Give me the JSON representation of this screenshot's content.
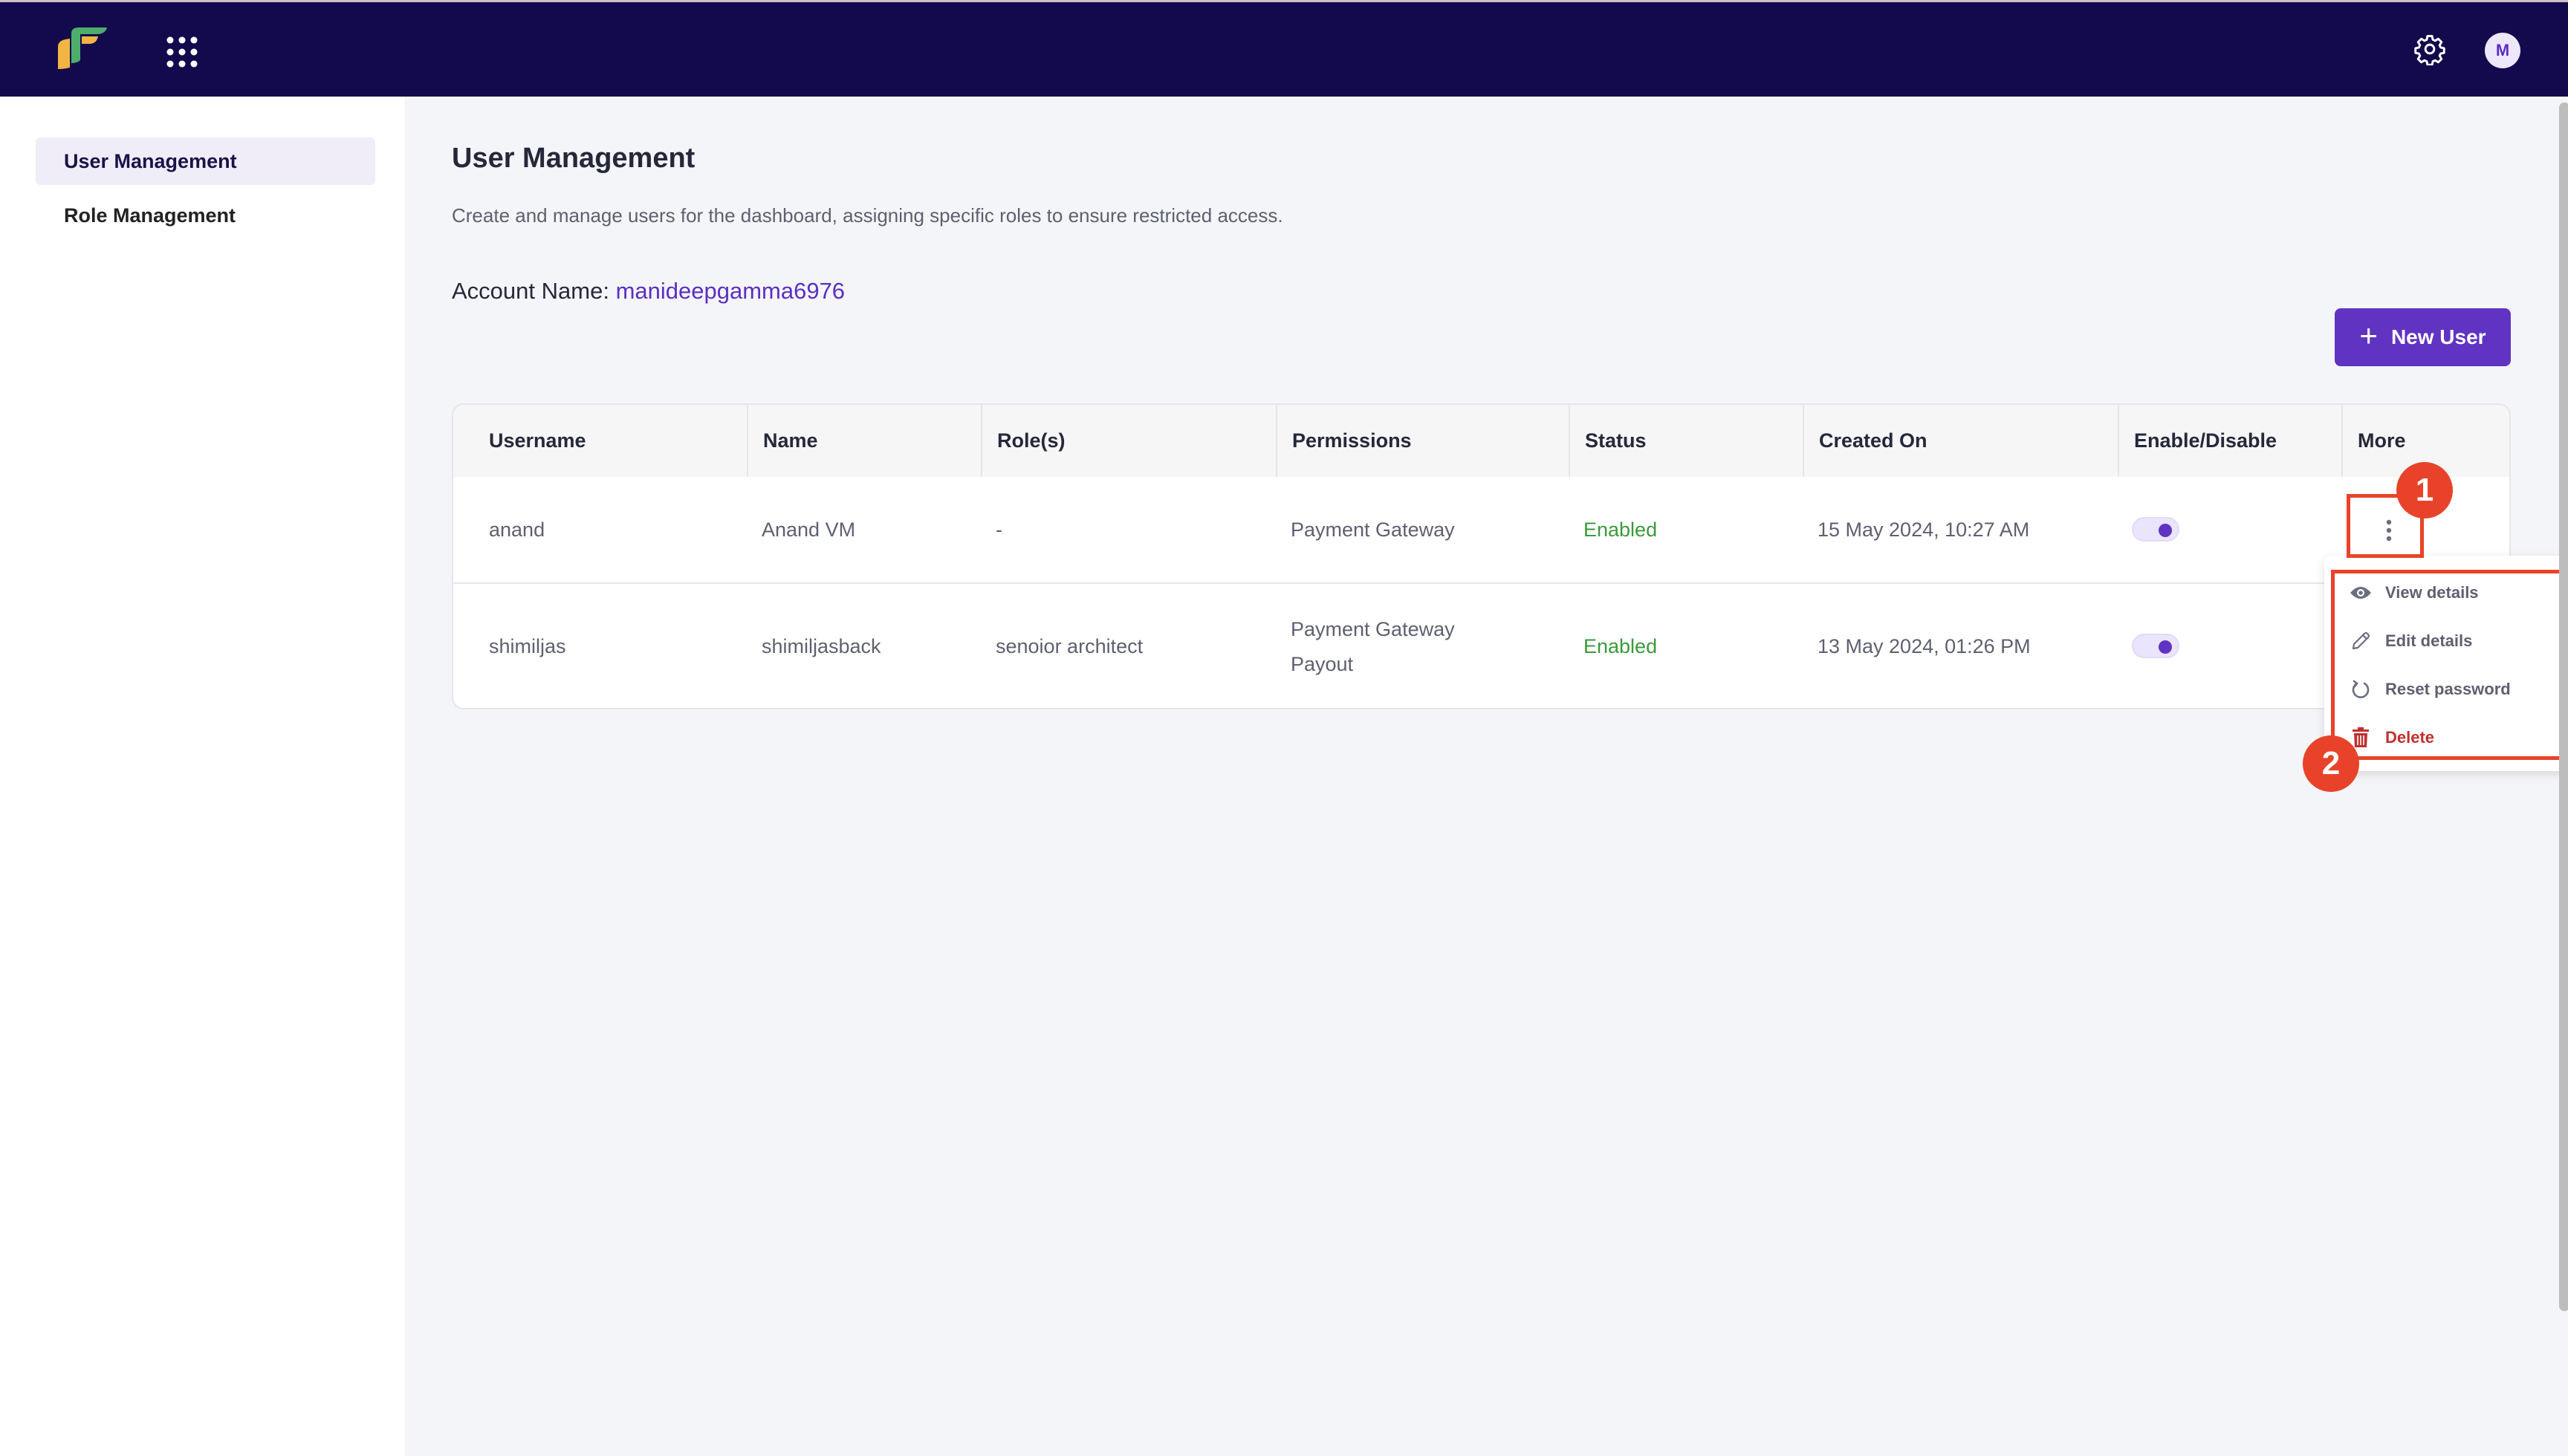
{
  "topbar": {
    "logo_icon": "brand-logo",
    "apps_icon": "grid-dots-icon",
    "settings_icon": "gear-icon",
    "avatar_initial": "M"
  },
  "sidebar": {
    "items": [
      {
        "label": "User Management",
        "active": true
      },
      {
        "label": "Role Management",
        "active": false
      }
    ]
  },
  "main": {
    "title": "User Management",
    "description": "Create and manage users for the dashboard, assigning specific roles to ensure restricted access.",
    "account_label": "Account Name:",
    "account_value": "manideepgamma6976",
    "new_user_button": {
      "icon": "plus-icon",
      "label": "New User"
    }
  },
  "table": {
    "columns": [
      "Username",
      "Name",
      "Role(s)",
      "Permissions",
      "Status",
      "Created On",
      "Enable/Disable",
      "More"
    ],
    "rows": [
      {
        "username": "anand",
        "name": "Anand VM",
        "roles": "-",
        "permissions": [
          "Payment Gateway"
        ],
        "status": "Enabled",
        "created_on": "15 May 2024, 10:27 AM",
        "enabled": true
      },
      {
        "username": "shimiljas",
        "name": "shimiljasback",
        "roles": "senoior architect",
        "permissions": [
          "Payment Gateway",
          "Payout"
        ],
        "status": "Enabled",
        "created_on": "13 May 2024, 01:26 PM",
        "enabled": true
      }
    ]
  },
  "more_menu": {
    "items": [
      {
        "label": "View details",
        "icon": "eye-icon"
      },
      {
        "label": "Edit details",
        "icon": "pencil-icon"
      },
      {
        "label": "Reset password",
        "icon": "reset-icon"
      },
      {
        "label": "Delete",
        "icon": "trash-icon"
      }
    ]
  },
  "annotations": {
    "badge_1": "1",
    "badge_2": "2"
  },
  "colors": {
    "topbar_bg": "#130A4D",
    "accent": "#6133C2",
    "status_enabled": "#3A9A3A",
    "delete": "#C0302F",
    "annotation": "#E8432A"
  }
}
